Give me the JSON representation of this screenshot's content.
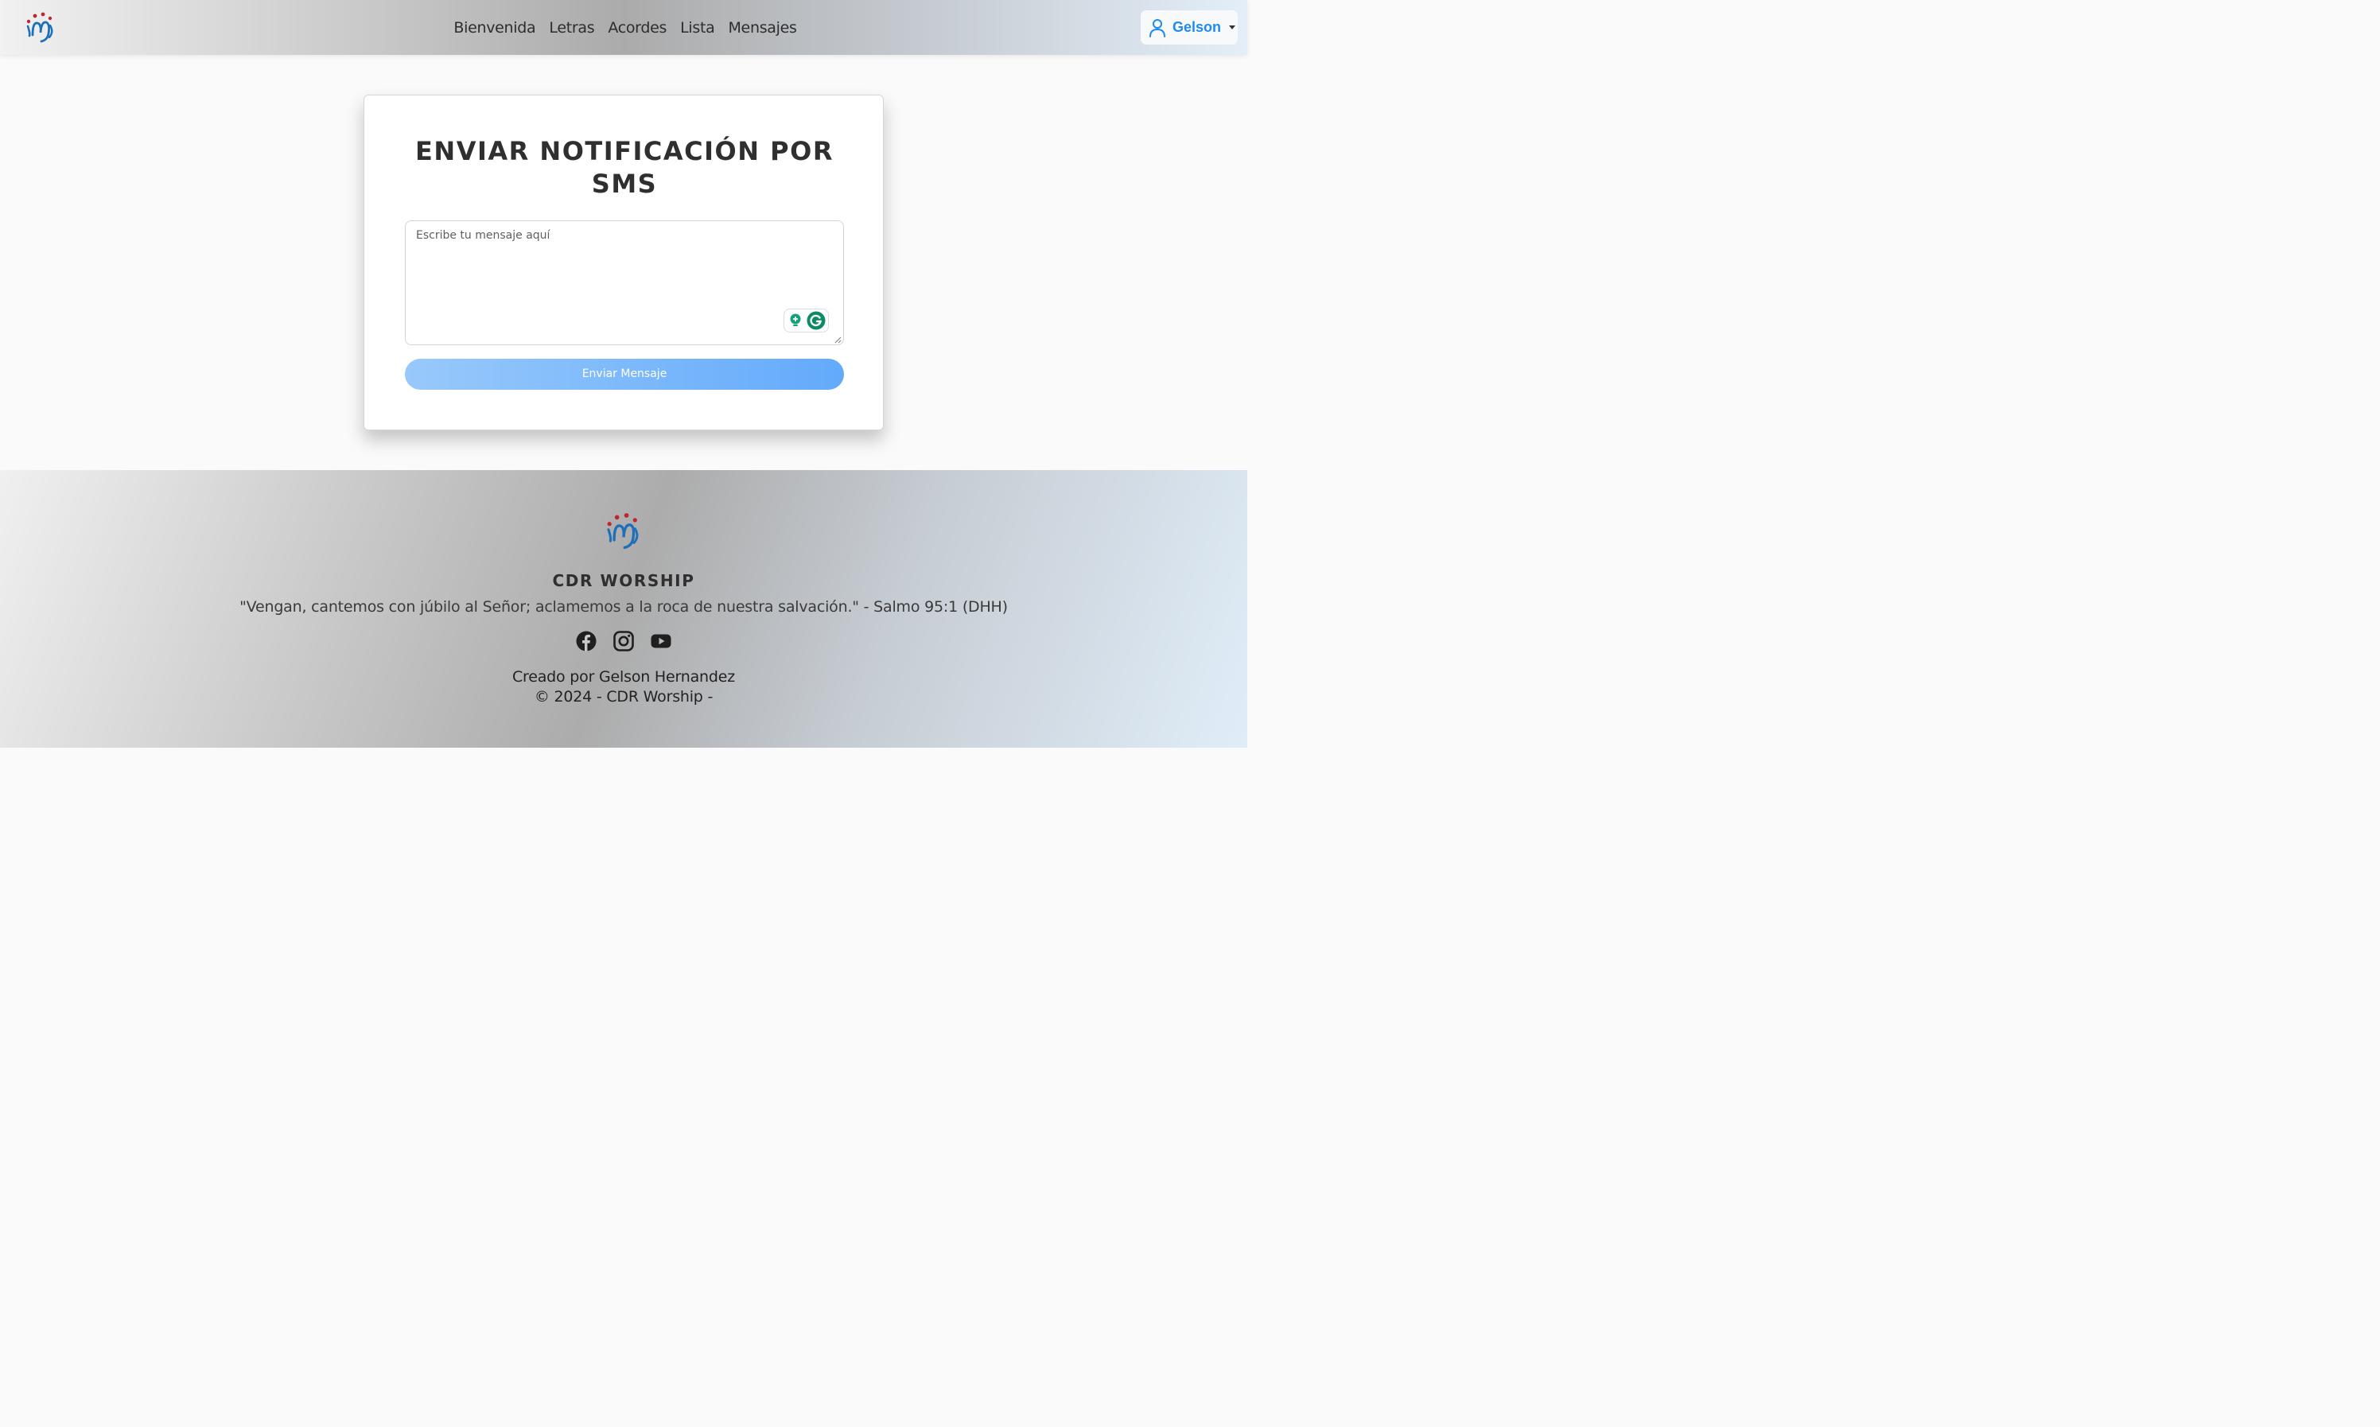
{
  "nav": {
    "links": [
      "Bienvenida",
      "Letras",
      "Acordes",
      "Lista",
      "Mensajes"
    ],
    "user": "Gelson"
  },
  "card": {
    "title": "ENVIAR NOTIFICACIÓN POR SMS",
    "placeholder": "Escribe tu mensaje aquí",
    "button": "Enviar Mensaje"
  },
  "footer": {
    "title": "CDR WORSHIP",
    "verse": "\"Vengan, cantemos con júbilo al Señor; aclamemos a la roca de nuestra salvación.\" - Salmo 95:1 (DHH)",
    "credit_line1": "Creado por Gelson Hernandez",
    "credit_line2": "© 2024 - CDR Worship -",
    "socials": [
      "facebook-icon",
      "instagram-icon",
      "youtube-icon"
    ]
  },
  "colors": {
    "accent": "#1d8cf0",
    "button_start": "#98c9fb",
    "button_end": "#63aafb",
    "logo_red": "#c0262d",
    "logo_blue": "#1d6fb8"
  }
}
